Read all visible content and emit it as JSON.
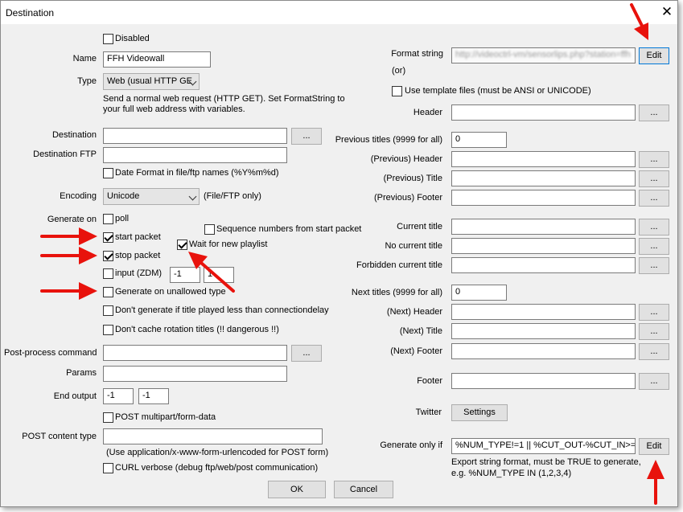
{
  "window": {
    "title": "Destination",
    "close": "✕"
  },
  "left": {
    "disabled_label": "Disabled",
    "name_label": "Name",
    "name_value": "FFH Videowall",
    "type_label": "Type",
    "type_value": "Web (usual HTTP GE",
    "type_desc_1": "Send a normal web request (HTTP GET). Set FormatString to",
    "type_desc_2": "your full web address with variables.",
    "destination_label": "Destination",
    "destination_value": "",
    "browse": "...",
    "destination_ftp_label": "Destination FTP",
    "date_format_label": "Date Format in file/ftp names (%Y%m%d)",
    "encoding_label": "Encoding",
    "encoding_value": "Unicode",
    "encoding_note": "(File/FTP only)",
    "generate_on_label": "Generate on",
    "poll_label": "poll",
    "sequence_label": "Sequence numbers from start packet",
    "start_packet_label": "start packet",
    "wait_playlist_label": "Wait for new playlist",
    "stop_packet_label": "stop packet",
    "input_label": "input (ZDM)",
    "input_value_1": "-1",
    "input_value_2": "1",
    "unallowed_label": "Generate on unallowed type",
    "dont_generate_label": "Don't generate if title played less than connectiondelay",
    "dont_cache_label": "Don't cache rotation titles (!! dangerous !!)",
    "post_process_label": "Post-process command",
    "params_label": "Params",
    "end_output_label": "End output",
    "end_output_1": "-1",
    "end_output_2": "-1",
    "post_multipart_label": "POST multipart/form-data",
    "post_content_type_label": "POST content type",
    "post_content_hint": "(Use application/x-www-form-urlencoded for POST form)",
    "curl_verbose_label": "CURL verbose (debug ftp/web/post communication)"
  },
  "right": {
    "format_string_label": "Format string",
    "or_label": "(or)",
    "format_string_value": "http://videoctrl-vm/sensorlips.php?station=ffh",
    "edit": "Edit",
    "use_template_label": "Use template files (must be ANSI or UNICODE)",
    "header_label": "Header",
    "previous_titles_label": "Previous titles (9999 for all)",
    "previous_titles_value": "0",
    "prev_header_label": "(Previous) Header",
    "prev_title_label": "(Previous) Title",
    "prev_footer_label": "(Previous) Footer",
    "current_title_label": "Current title",
    "no_current_title_label": "No current title",
    "forbidden_current_label": "Forbidden current title",
    "next_titles_label": "Next titles (9999 for all)",
    "next_titles_value": "0",
    "next_header_label": "(Next) Header",
    "next_title_label": "(Next) Title",
    "next_footer_label": "(Next) Footer",
    "footer_label": "Footer",
    "twitter_label": "Twitter",
    "settings_button": "Settings",
    "generate_only_label": "Generate only if",
    "generate_only_value": "%NUM_TYPE!=1 || %CUT_OUT-%CUT_IN>=",
    "export_note_1": "Export string format, must be TRUE to generate,",
    "export_note_2": "e.g. %NUM_TYPE IN (1,2,3,4)"
  },
  "footer": {
    "ok": "OK",
    "cancel": "Cancel"
  },
  "colors": {
    "arrow": "#e8120c",
    "dialog_bg": "#f0f0f0",
    "focus_border": "#0078d7"
  }
}
